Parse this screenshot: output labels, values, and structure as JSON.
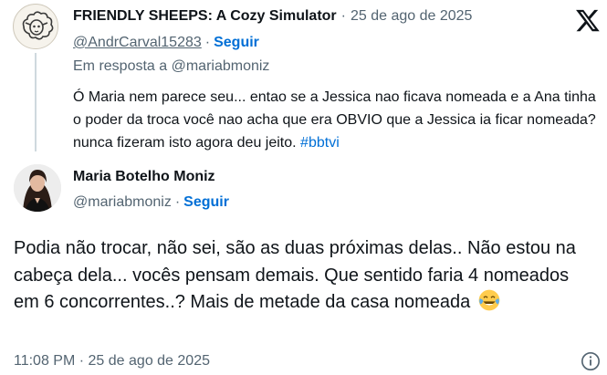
{
  "parent_tweet": {
    "author_name": "FRIENDLY SHEEPS: A Cozy Simulator",
    "date": "25 de ago de 2025",
    "handle": "@AndrCarval15283",
    "follow_label": "Seguir",
    "reply_to": "Em resposta a @mariabmoniz",
    "text": "Ó Maria nem parece seu... entao se a Jessica nao ficava nomeada e a Ana  tinha o poder da troca você nao acha que era OBVIO que a Jessica ia ficar nomeada? nunca fizeram isto agora deu jeito.",
    "hashtag": "#bbtvi",
    "avatar_icon": "sheep-avatar"
  },
  "main_tweet": {
    "author_name": "Maria Botelho Moniz",
    "handle": "@mariabmoniz",
    "follow_label": "Seguir",
    "text": "Podia não trocar, não sei, são as duas próximas delas.. Não estou na cabeça dela... vocês pensam demais. Que sentido faria 4 nomeados em 6 concorrentes..? Mais de metade da casa nomeada",
    "emoji": "face-with-tears-of-joy",
    "time": "11:08 PM",
    "date": "25 de ago de 2025"
  },
  "icons": {
    "brand": "x-logo",
    "info": "info-icon"
  },
  "colors": {
    "link": "#006fd6",
    "secondary_text": "#536471",
    "primary_text": "#0f1419",
    "thread_line": "#cfd9de"
  }
}
